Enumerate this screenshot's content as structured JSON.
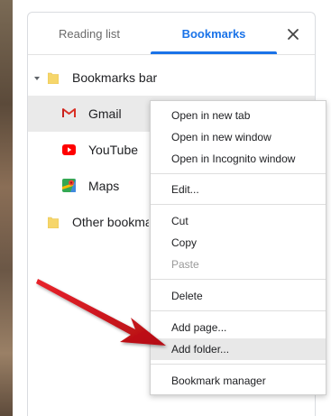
{
  "tabs": {
    "reading_list": "Reading list",
    "bookmarks": "Bookmarks"
  },
  "tree": {
    "bookmarks_bar": "Bookmarks bar",
    "items": [
      {
        "label": "Gmail"
      },
      {
        "label": "YouTube"
      },
      {
        "label": "Maps"
      }
    ],
    "other_bookmarks": "Other bookmarks"
  },
  "context_menu": {
    "open_new_tab": "Open in new tab",
    "open_new_window": "Open in new window",
    "open_incognito": "Open in Incognito window",
    "edit": "Edit...",
    "cut": "Cut",
    "copy": "Copy",
    "paste": "Paste",
    "delete": "Delete",
    "add_page": "Add page...",
    "add_folder": "Add folder...",
    "bookmark_manager": "Bookmark manager"
  },
  "colors": {
    "accent": "#1a73e8",
    "arrow": "#d3141c",
    "menu_hover": "#e8e8e8",
    "selected_row": "#eaeaea"
  },
  "icons": [
    "close-icon",
    "chevron-down-icon",
    "folder-icon",
    "gmail-icon",
    "youtube-icon",
    "maps-icon"
  ]
}
